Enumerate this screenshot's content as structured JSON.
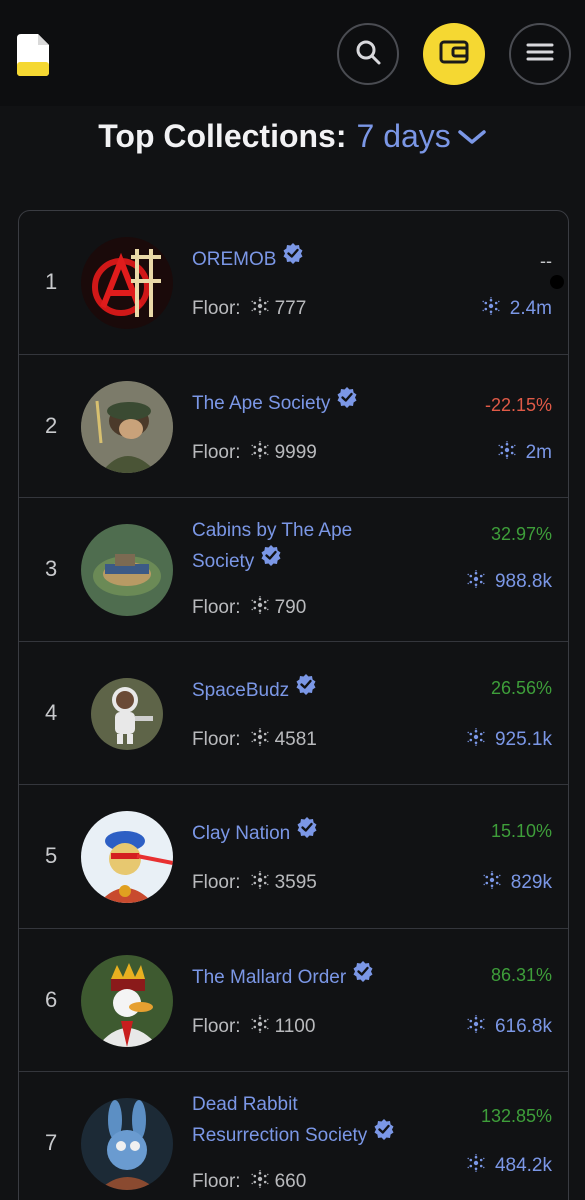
{
  "header": {
    "logo_icon": "document-logo-icon",
    "search_icon": "search-icon",
    "wallet_icon": "wallet-icon",
    "menu_icon": "hamburger-menu-icon",
    "accent_color": "#f5d832"
  },
  "section": {
    "title": "Top Collections:",
    "period": "7 days"
  },
  "floor_label": "Floor:",
  "collections": [
    {
      "rank": "1",
      "name_line1": "OREMOB",
      "name_line2": "",
      "floor": "777",
      "change": "--",
      "change_type": "neu",
      "volume": "2.4m"
    },
    {
      "rank": "2",
      "name_line1": "The Ape Society",
      "name_line2": "",
      "floor": "9999",
      "change": "-22.15%",
      "change_type": "neg",
      "volume": "2m"
    },
    {
      "rank": "3",
      "name_line1": "Cabins by The Ape",
      "name_line2": "Society",
      "floor": "790",
      "change": "32.97%",
      "change_type": "pos",
      "volume": "988.8k"
    },
    {
      "rank": "4",
      "name_line1": "SpaceBudz",
      "name_line2": "",
      "floor": "4581",
      "change": "26.56%",
      "change_type": "pos",
      "volume": "925.1k"
    },
    {
      "rank": "5",
      "name_line1": "Clay Nation",
      "name_line2": "",
      "floor": "3595",
      "change": "15.10%",
      "change_type": "pos",
      "volume": "829k"
    },
    {
      "rank": "6",
      "name_line1": "The Mallard Order",
      "name_line2": "",
      "floor": "1100",
      "change": "86.31%",
      "change_type": "pos",
      "volume": "616.8k"
    },
    {
      "rank": "7",
      "name_line1": "Dead Rabbit",
      "name_line2": "Resurrection Society",
      "floor": "660",
      "change": "132.85%",
      "change_type": "pos",
      "volume": "484.2k"
    }
  ]
}
